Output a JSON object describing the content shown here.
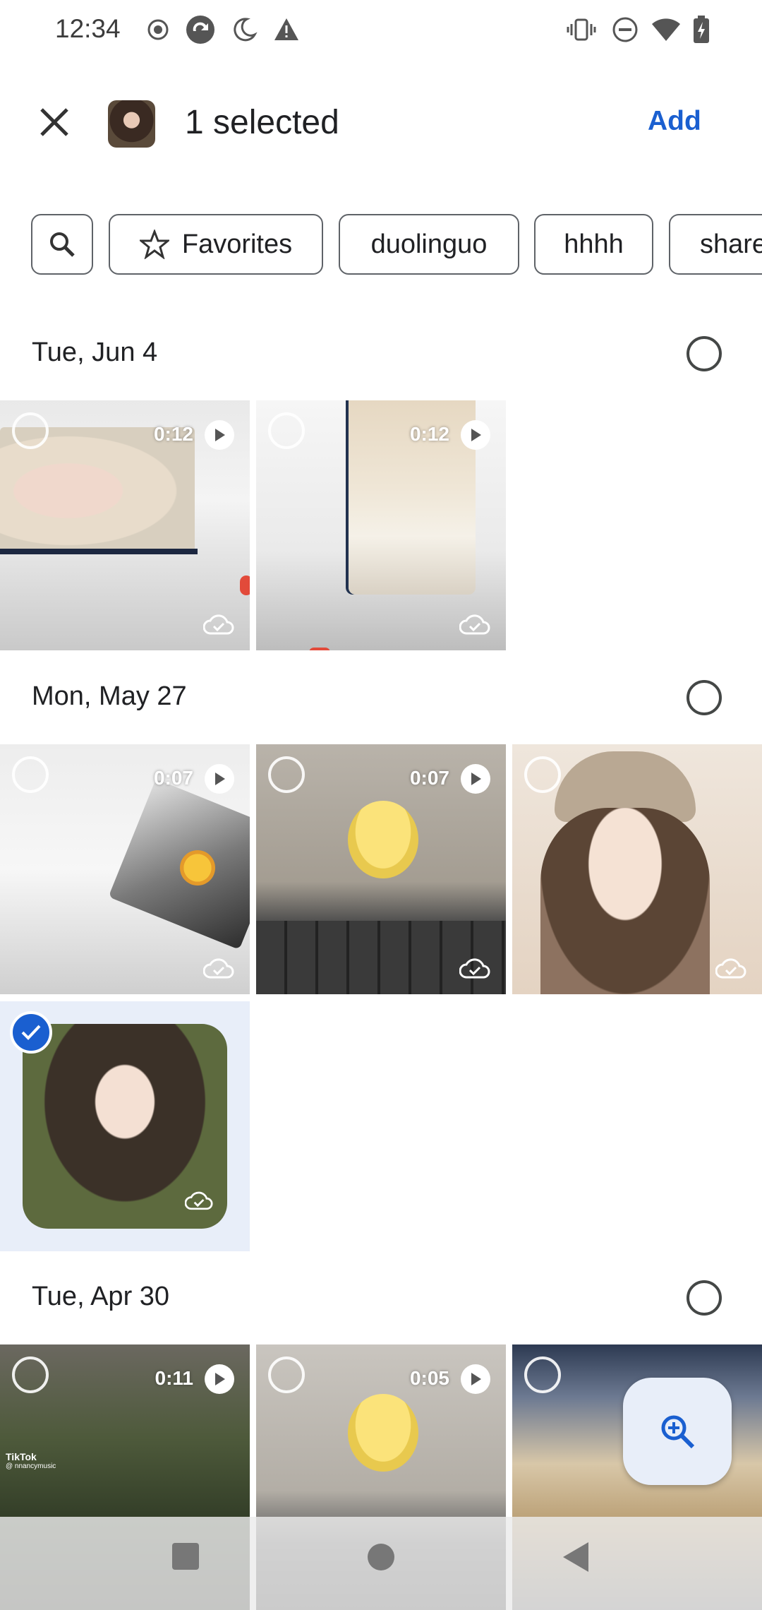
{
  "status_bar": {
    "time": "12:34",
    "left_icons": [
      "record-icon",
      "sync-icon",
      "moon-icon",
      "warning-icon"
    ],
    "right_icons": [
      "vibrate-icon",
      "dnd-icon",
      "wifi-icon",
      "battery-icon"
    ]
  },
  "header": {
    "selected_text": "1 selected",
    "add_label": "Add"
  },
  "chips": [
    {
      "label": "",
      "icon": "search-icon"
    },
    {
      "label": "Favorites",
      "icon": "star-icon"
    },
    {
      "label": "duolinguo"
    },
    {
      "label": "hhhh"
    },
    {
      "label": "share"
    }
  ],
  "sections": [
    {
      "date": "Tue, Jun 4"
    },
    {
      "date": "Mon, May 27"
    },
    {
      "date": "Tue, Apr 30"
    }
  ],
  "tiles": {
    "jun4_1": {
      "duration": "0:12"
    },
    "jun4_2": {
      "duration": "0:12"
    },
    "may27_1": {
      "duration": "0:07"
    },
    "may27_2": {
      "duration": "0:07"
    },
    "apr30_1": {
      "duration": "0:11",
      "watermark": "TikTok",
      "watermark_user": "@ nnancymusic"
    },
    "apr30_2": {
      "duration": "0:05"
    }
  },
  "colors": {
    "accent": "#1a5fd0",
    "selected_bg": "#e8eef9"
  }
}
